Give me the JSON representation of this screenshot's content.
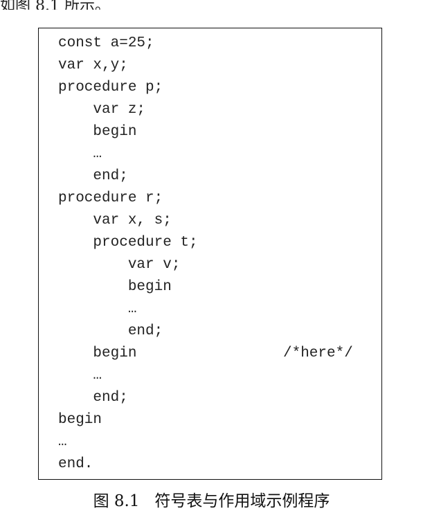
{
  "header_fragment": "如图 8.1 所示。",
  "code_lines": [
    "const a=25;",
    "var x,y;",
    "procedure p;",
    "    var z;",
    "    begin",
    "    …",
    "    end;",
    "procedure r;",
    "    var x, s;",
    "    procedure t;",
    "        var v;",
    "        begin",
    "        …",
    "        end;",
    "    begin",
    "    …",
    "    end;",
    "begin",
    "…",
    "end."
  ],
  "here_comment": "/*here*/",
  "caption": "图 8.1   符号表与作用域示例程序"
}
